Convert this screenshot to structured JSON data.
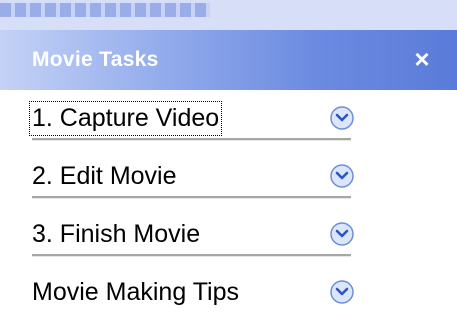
{
  "panel": {
    "title": "Movie Tasks",
    "close_label": "×"
  },
  "tasks": [
    {
      "label": "1. Capture Video",
      "focused": true
    },
    {
      "label": "2. Edit Movie",
      "focused": false
    },
    {
      "label": "3. Finish Movie",
      "focused": false
    },
    {
      "label": "Movie Making Tips",
      "focused": false
    }
  ],
  "colors": {
    "header_start": "#c4d2f5",
    "header_end": "#5a7bd9",
    "chevron_fill": "#dce6fb",
    "chevron_stroke": "#6c8ed8",
    "chevron_arrow": "#2b55c7"
  },
  "icons": {
    "expand": "chevron-down-icon",
    "close": "close-icon"
  }
}
